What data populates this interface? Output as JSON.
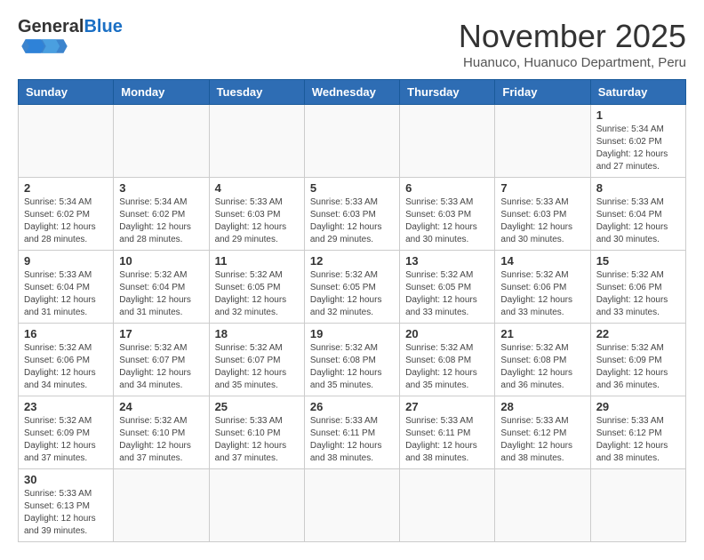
{
  "header": {
    "logo_general": "General",
    "logo_blue": "Blue",
    "month_title": "November 2025",
    "subtitle": "Huanuco, Huanuco Department, Peru"
  },
  "weekdays": [
    "Sunday",
    "Monday",
    "Tuesday",
    "Wednesday",
    "Thursday",
    "Friday",
    "Saturday"
  ],
  "days": [
    {
      "num": "",
      "info": ""
    },
    {
      "num": "",
      "info": ""
    },
    {
      "num": "",
      "info": ""
    },
    {
      "num": "",
      "info": ""
    },
    {
      "num": "",
      "info": ""
    },
    {
      "num": "",
      "info": ""
    },
    {
      "num": "1",
      "info": "Sunrise: 5:34 AM\nSunset: 6:02 PM\nDaylight: 12 hours\nand 27 minutes."
    },
    {
      "num": "2",
      "info": "Sunrise: 5:34 AM\nSunset: 6:02 PM\nDaylight: 12 hours\nand 28 minutes."
    },
    {
      "num": "3",
      "info": "Sunrise: 5:34 AM\nSunset: 6:02 PM\nDaylight: 12 hours\nand 28 minutes."
    },
    {
      "num": "4",
      "info": "Sunrise: 5:33 AM\nSunset: 6:03 PM\nDaylight: 12 hours\nand 29 minutes."
    },
    {
      "num": "5",
      "info": "Sunrise: 5:33 AM\nSunset: 6:03 PM\nDaylight: 12 hours\nand 29 minutes."
    },
    {
      "num": "6",
      "info": "Sunrise: 5:33 AM\nSunset: 6:03 PM\nDaylight: 12 hours\nand 30 minutes."
    },
    {
      "num": "7",
      "info": "Sunrise: 5:33 AM\nSunset: 6:03 PM\nDaylight: 12 hours\nand 30 minutes."
    },
    {
      "num": "8",
      "info": "Sunrise: 5:33 AM\nSunset: 6:04 PM\nDaylight: 12 hours\nand 30 minutes."
    },
    {
      "num": "9",
      "info": "Sunrise: 5:33 AM\nSunset: 6:04 PM\nDaylight: 12 hours\nand 31 minutes."
    },
    {
      "num": "10",
      "info": "Sunrise: 5:32 AM\nSunset: 6:04 PM\nDaylight: 12 hours\nand 31 minutes."
    },
    {
      "num": "11",
      "info": "Sunrise: 5:32 AM\nSunset: 6:05 PM\nDaylight: 12 hours\nand 32 minutes."
    },
    {
      "num": "12",
      "info": "Sunrise: 5:32 AM\nSunset: 6:05 PM\nDaylight: 12 hours\nand 32 minutes."
    },
    {
      "num": "13",
      "info": "Sunrise: 5:32 AM\nSunset: 6:05 PM\nDaylight: 12 hours\nand 33 minutes."
    },
    {
      "num": "14",
      "info": "Sunrise: 5:32 AM\nSunset: 6:06 PM\nDaylight: 12 hours\nand 33 minutes."
    },
    {
      "num": "15",
      "info": "Sunrise: 5:32 AM\nSunset: 6:06 PM\nDaylight: 12 hours\nand 33 minutes."
    },
    {
      "num": "16",
      "info": "Sunrise: 5:32 AM\nSunset: 6:06 PM\nDaylight: 12 hours\nand 34 minutes."
    },
    {
      "num": "17",
      "info": "Sunrise: 5:32 AM\nSunset: 6:07 PM\nDaylight: 12 hours\nand 34 minutes."
    },
    {
      "num": "18",
      "info": "Sunrise: 5:32 AM\nSunset: 6:07 PM\nDaylight: 12 hours\nand 35 minutes."
    },
    {
      "num": "19",
      "info": "Sunrise: 5:32 AM\nSunset: 6:08 PM\nDaylight: 12 hours\nand 35 minutes."
    },
    {
      "num": "20",
      "info": "Sunrise: 5:32 AM\nSunset: 6:08 PM\nDaylight: 12 hours\nand 35 minutes."
    },
    {
      "num": "21",
      "info": "Sunrise: 5:32 AM\nSunset: 6:08 PM\nDaylight: 12 hours\nand 36 minutes."
    },
    {
      "num": "22",
      "info": "Sunrise: 5:32 AM\nSunset: 6:09 PM\nDaylight: 12 hours\nand 36 minutes."
    },
    {
      "num": "23",
      "info": "Sunrise: 5:32 AM\nSunset: 6:09 PM\nDaylight: 12 hours\nand 37 minutes."
    },
    {
      "num": "24",
      "info": "Sunrise: 5:32 AM\nSunset: 6:10 PM\nDaylight: 12 hours\nand 37 minutes."
    },
    {
      "num": "25",
      "info": "Sunrise: 5:33 AM\nSunset: 6:10 PM\nDaylight: 12 hours\nand 37 minutes."
    },
    {
      "num": "26",
      "info": "Sunrise: 5:33 AM\nSunset: 6:11 PM\nDaylight: 12 hours\nand 38 minutes."
    },
    {
      "num": "27",
      "info": "Sunrise: 5:33 AM\nSunset: 6:11 PM\nDaylight: 12 hours\nand 38 minutes."
    },
    {
      "num": "28",
      "info": "Sunrise: 5:33 AM\nSunset: 6:12 PM\nDaylight: 12 hours\nand 38 minutes."
    },
    {
      "num": "29",
      "info": "Sunrise: 5:33 AM\nSunset: 6:12 PM\nDaylight: 12 hours\nand 38 minutes."
    },
    {
      "num": "30",
      "info": "Sunrise: 5:33 AM\nSunset: 6:13 PM\nDaylight: 12 hours\nand 39 minutes."
    },
    {
      "num": "",
      "info": ""
    },
    {
      "num": "",
      "info": ""
    },
    {
      "num": "",
      "info": ""
    },
    {
      "num": "",
      "info": ""
    },
    {
      "num": "",
      "info": ""
    },
    {
      "num": "",
      "info": ""
    }
  ]
}
